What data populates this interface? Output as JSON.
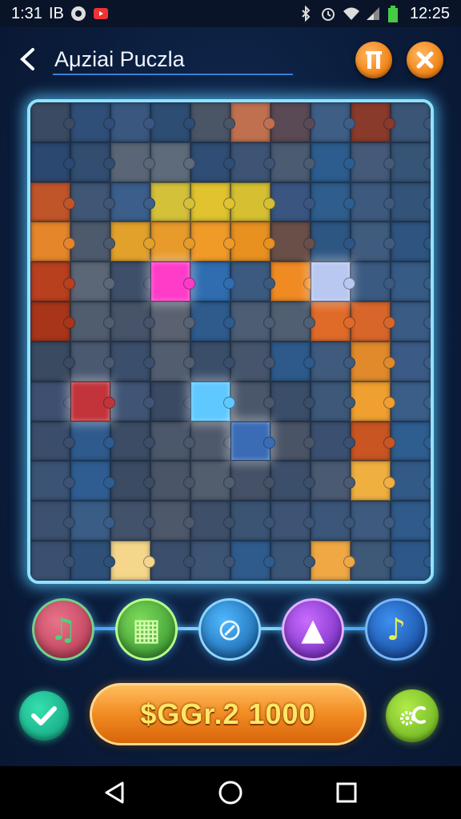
{
  "status_bar": {
    "left_time": "1:31",
    "carrier_label": "IB",
    "right_time": "12:25",
    "icons": [
      "gallery-icon",
      "camera-icon",
      "youtube-icon",
      "bluetooth-icon",
      "alarm-icon",
      "wifi-icon",
      "signal-icon",
      "battery-icon"
    ]
  },
  "header": {
    "title": "Aμziai Puczla",
    "back_icon": "chevron-left-icon",
    "pause_icon": "pause-icon",
    "close_icon": "close-icon"
  },
  "board": {
    "columns": 10,
    "rows": 12,
    "accent": "#8fe3ff",
    "pieces": [
      "#3b4a63",
      "#2f4f78",
      "#3a577f",
      "#2d4d73",
      "#4a5566",
      "#c0704f",
      "#5a4a55",
      "#3e5e86",
      "#8a3a2a",
      "#3b5577",
      "#2b4870",
      "#324d70",
      "#5a6677",
      "#5e6b7a",
      "#2f4d75",
      "#3d5474",
      "#4a5b72",
      "#2c5d8e",
      "#445a78",
      "#365476",
      "#c0552a",
      "#3f5674",
      "#3b5e8a",
      "#d4c13a",
      "#e0c32e",
      "#d6c032",
      "#3a5680",
      "#2f5d8c",
      "#3d5a7e",
      "#335478",
      "#e5862a",
      "#4d5a6d",
      "#e2a12a",
      "#e89a2a",
      "#f09a28",
      "#e89020",
      "#6a4f48",
      "#2e5683",
      "#3f5b7e",
      "#2e5480",
      "#b8401e",
      "#5b6676",
      "#3e4f69",
      "#ff3cc8",
      "#2f6db0",
      "#3c5a80",
      "#f08a22",
      "#b9c8f0",
      "#3a5a82",
      "#365b85",
      "#a8351a",
      "#505d6e",
      "#465368",
      "#5a6272",
      "#2e5a8c",
      "#4c5d74",
      "#515f72",
      "#e06a28",
      "#d8662a",
      "#3a5b84",
      "#3a4a60",
      "#4a5870",
      "#3b4e6b",
      "#525e70",
      "#3a4e6a",
      "#46556c",
      "#2d5a8a",
      "#3f5a7d",
      "#e08a2c",
      "#3b5b86",
      "#3e5070",
      "#c2343a",
      "#405475",
      "#3a4a63",
      "#5fc9ff",
      "#4a566a",
      "#3a4d69",
      "#3d5878",
      "#f0a030",
      "#3b5e88",
      "#3a4d6b",
      "#2e5a8d",
      "#3b4c64",
      "#4b576a",
      "#4e5a6c",
      "#3a6cb5",
      "#4a5467",
      "#3b5070",
      "#c85522",
      "#2e5d8f",
      "#3b5374",
      "#2f5d92",
      "#3a4b62",
      "#4a5568",
      "#525d6e",
      "#445166",
      "#3c4f6a",
      "#4a5a72",
      "#f0b040",
      "#335a86",
      "#3c5070",
      "#3a5d86",
      "#43526b",
      "#4d586a",
      "#3e4f6a",
      "#3b5474",
      "#3e5474",
      "#3b5679",
      "#3e5a7e",
      "#2f5a8a",
      "#3a5070",
      "#2e5078",
      "#f5d68a",
      "#3b4f6c",
      "#3d5475",
      "#2f5b8c",
      "#3a5576",
      "#f0a845",
      "#3e5878",
      "#2d5789"
    ],
    "glow_indices": [
      43,
      47,
      71,
      74,
      85
    ]
  },
  "tools": [
    {
      "name": "music-note-icon",
      "glyph": "♫",
      "color": "#b2344e"
    },
    {
      "name": "map-icon",
      "glyph": "▦",
      "color": "#2d8a2a"
    },
    {
      "name": "search-icon",
      "glyph": "⊘",
      "color": "#10579b"
    },
    {
      "name": "triangle-icon",
      "glyph": "▲",
      "color": "#6722b5"
    },
    {
      "name": "music-note-icon",
      "glyph": "♪",
      "color": "#0e3e8c"
    }
  ],
  "actions": {
    "confirm_icon": "checkmark-icon",
    "score_label": "$GGr.2 1000",
    "settings_icon": "settings-icon"
  },
  "nav": {
    "back_icon": "nav-back-icon",
    "home_icon": "nav-home-icon",
    "recents_icon": "nav-recents-icon"
  }
}
